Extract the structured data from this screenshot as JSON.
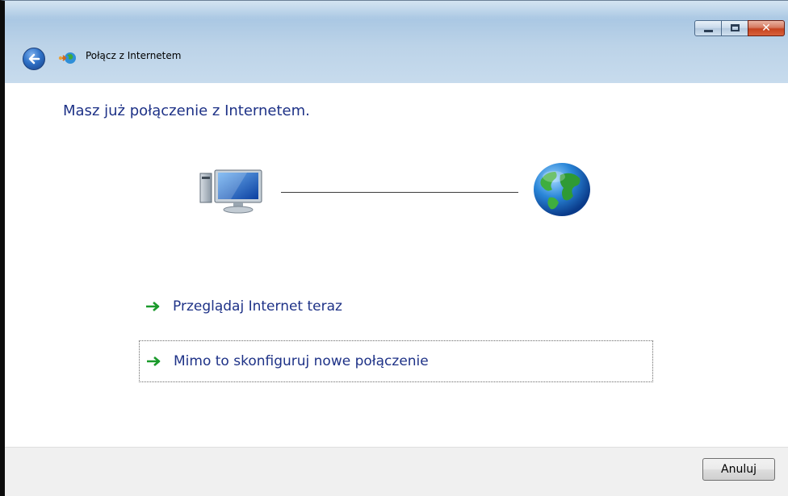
{
  "window": {
    "title": "Połącz z Internetem",
    "caption_buttons": {
      "minimize": "minimize",
      "maximize": "maximize",
      "close": "✕"
    }
  },
  "content": {
    "headline": "Masz już połączenie z Internetem."
  },
  "choices": [
    {
      "label": "Przeglądaj Internet teraz"
    },
    {
      "label": "Mimo to skonfiguruj nowe połączenie"
    }
  ],
  "footer": {
    "cancel_label": "Anuluj"
  },
  "icons": {
    "back": "back-arrow-icon",
    "app": "network-globe-icon",
    "computer": "computer-icon",
    "globe": "globe-icon",
    "choice_arrow": "green-arrow-icon"
  },
  "colors": {
    "headline": "#1e3287",
    "arrow": "#1a9a2b",
    "titlebar": "#bcd5ea",
    "footer": "#f0f0f0"
  }
}
